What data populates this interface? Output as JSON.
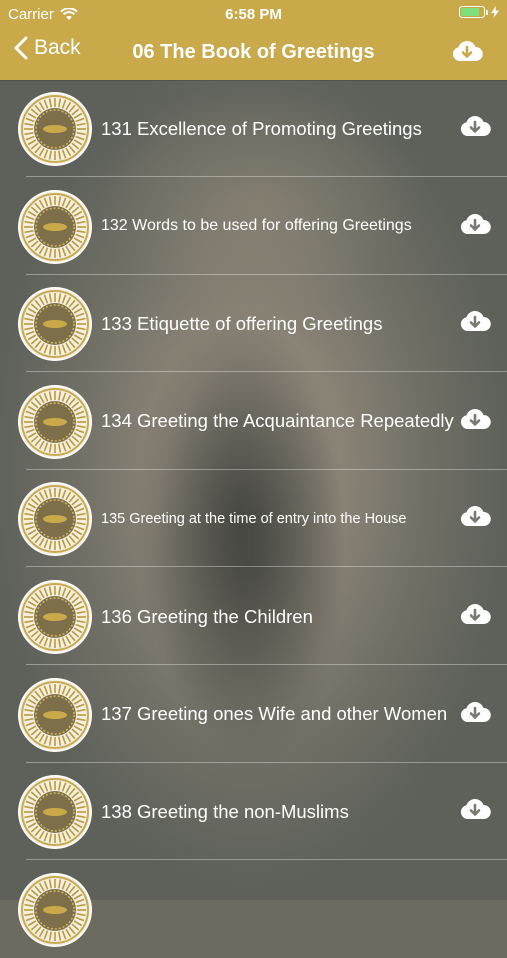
{
  "status_bar": {
    "carrier": "Carrier",
    "time": "6:58 PM",
    "battery_level": 0.85
  },
  "nav": {
    "back_label": "Back",
    "title": "06 The Book of Greetings",
    "download_icon": "cloud-download-icon"
  },
  "colors": {
    "nav_background": "#c9a94a",
    "text": "#ffffff",
    "battery_fill": "#7ee07a"
  },
  "chapters": [
    {
      "label": "131 Excellence of Promoting Greetings"
    },
    {
      "label": "132 Words to be used for offering Greetings"
    },
    {
      "label": "133 Etiquette of offering Greetings"
    },
    {
      "label": "134 Greeting the Acquaintance Repeatedly"
    },
    {
      "label": "135 Greeting at the time of entry into the House"
    },
    {
      "label": "136 Greeting the Children"
    },
    {
      "label": "137 Greeting ones Wife and other Women"
    },
    {
      "label": "138 Greeting the non-Muslims"
    },
    {
      "label": ""
    }
  ]
}
